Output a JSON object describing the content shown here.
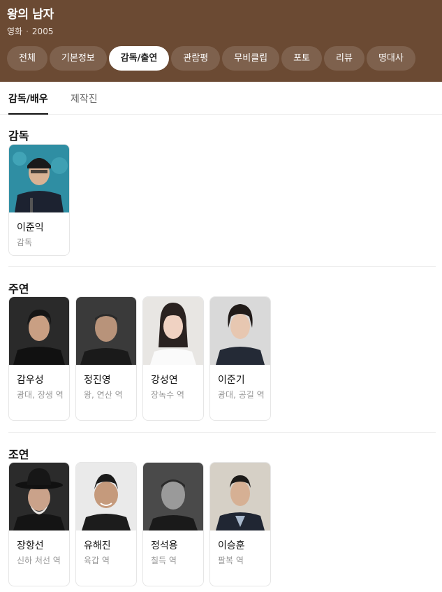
{
  "header": {
    "title": "왕의 남자",
    "genre": "영화",
    "year": "2005",
    "bg_color": "#6b4a33"
  },
  "tabs": [
    {
      "label": "전체",
      "active": false
    },
    {
      "label": "기본정보",
      "active": false
    },
    {
      "label": "감독/출연",
      "active": true
    },
    {
      "label": "관람평",
      "active": false
    },
    {
      "label": "무비클립",
      "active": false
    },
    {
      "label": "포토",
      "active": false
    },
    {
      "label": "리뷰",
      "active": false
    },
    {
      "label": "명대사",
      "active": false
    }
  ],
  "subtabs": [
    {
      "label": "감독/배우",
      "active": true
    },
    {
      "label": "제작진",
      "active": false
    }
  ],
  "sections": {
    "director": {
      "title": "감독",
      "people": [
        {
          "name": "이준익",
          "role": "감독"
        }
      ]
    },
    "lead": {
      "title": "주연",
      "people": [
        {
          "name": "감우성",
          "role": "광대, 장생 역"
        },
        {
          "name": "정진영",
          "role": "왕, 연산 역"
        },
        {
          "name": "강성연",
          "role": "장녹수 역"
        },
        {
          "name": "이준기",
          "role": "광대, 공길 역"
        }
      ]
    },
    "supporting": {
      "title": "조연",
      "people": [
        {
          "name": "장항선",
          "role": "신하 처선 역"
        },
        {
          "name": "유해진",
          "role": "육갑 역"
        },
        {
          "name": "정석용",
          "role": "칠득 역"
        },
        {
          "name": "이승훈",
          "role": "팔복 역"
        }
      ]
    }
  }
}
